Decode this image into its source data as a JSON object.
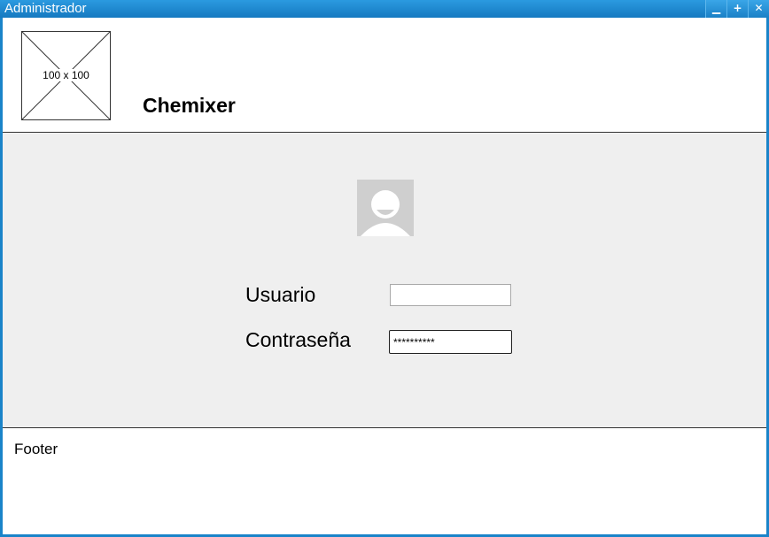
{
  "window": {
    "title": "Administrador",
    "controls": {
      "minimize": "▁",
      "maximize": "+",
      "close": "✕"
    }
  },
  "header": {
    "logo_placeholder_text": "100 x 100",
    "brand_name": "Chemixer"
  },
  "login": {
    "avatar_icon": "user-avatar-icon",
    "username_label": "Usuario",
    "username_value": "",
    "password_label": "Contraseña",
    "password_value": "**********"
  },
  "footer": {
    "text": "Footer"
  },
  "colors": {
    "titlebar": "#1a84c9",
    "main_bg": "#efefef",
    "avatar_bg": "#cfcfcf"
  }
}
